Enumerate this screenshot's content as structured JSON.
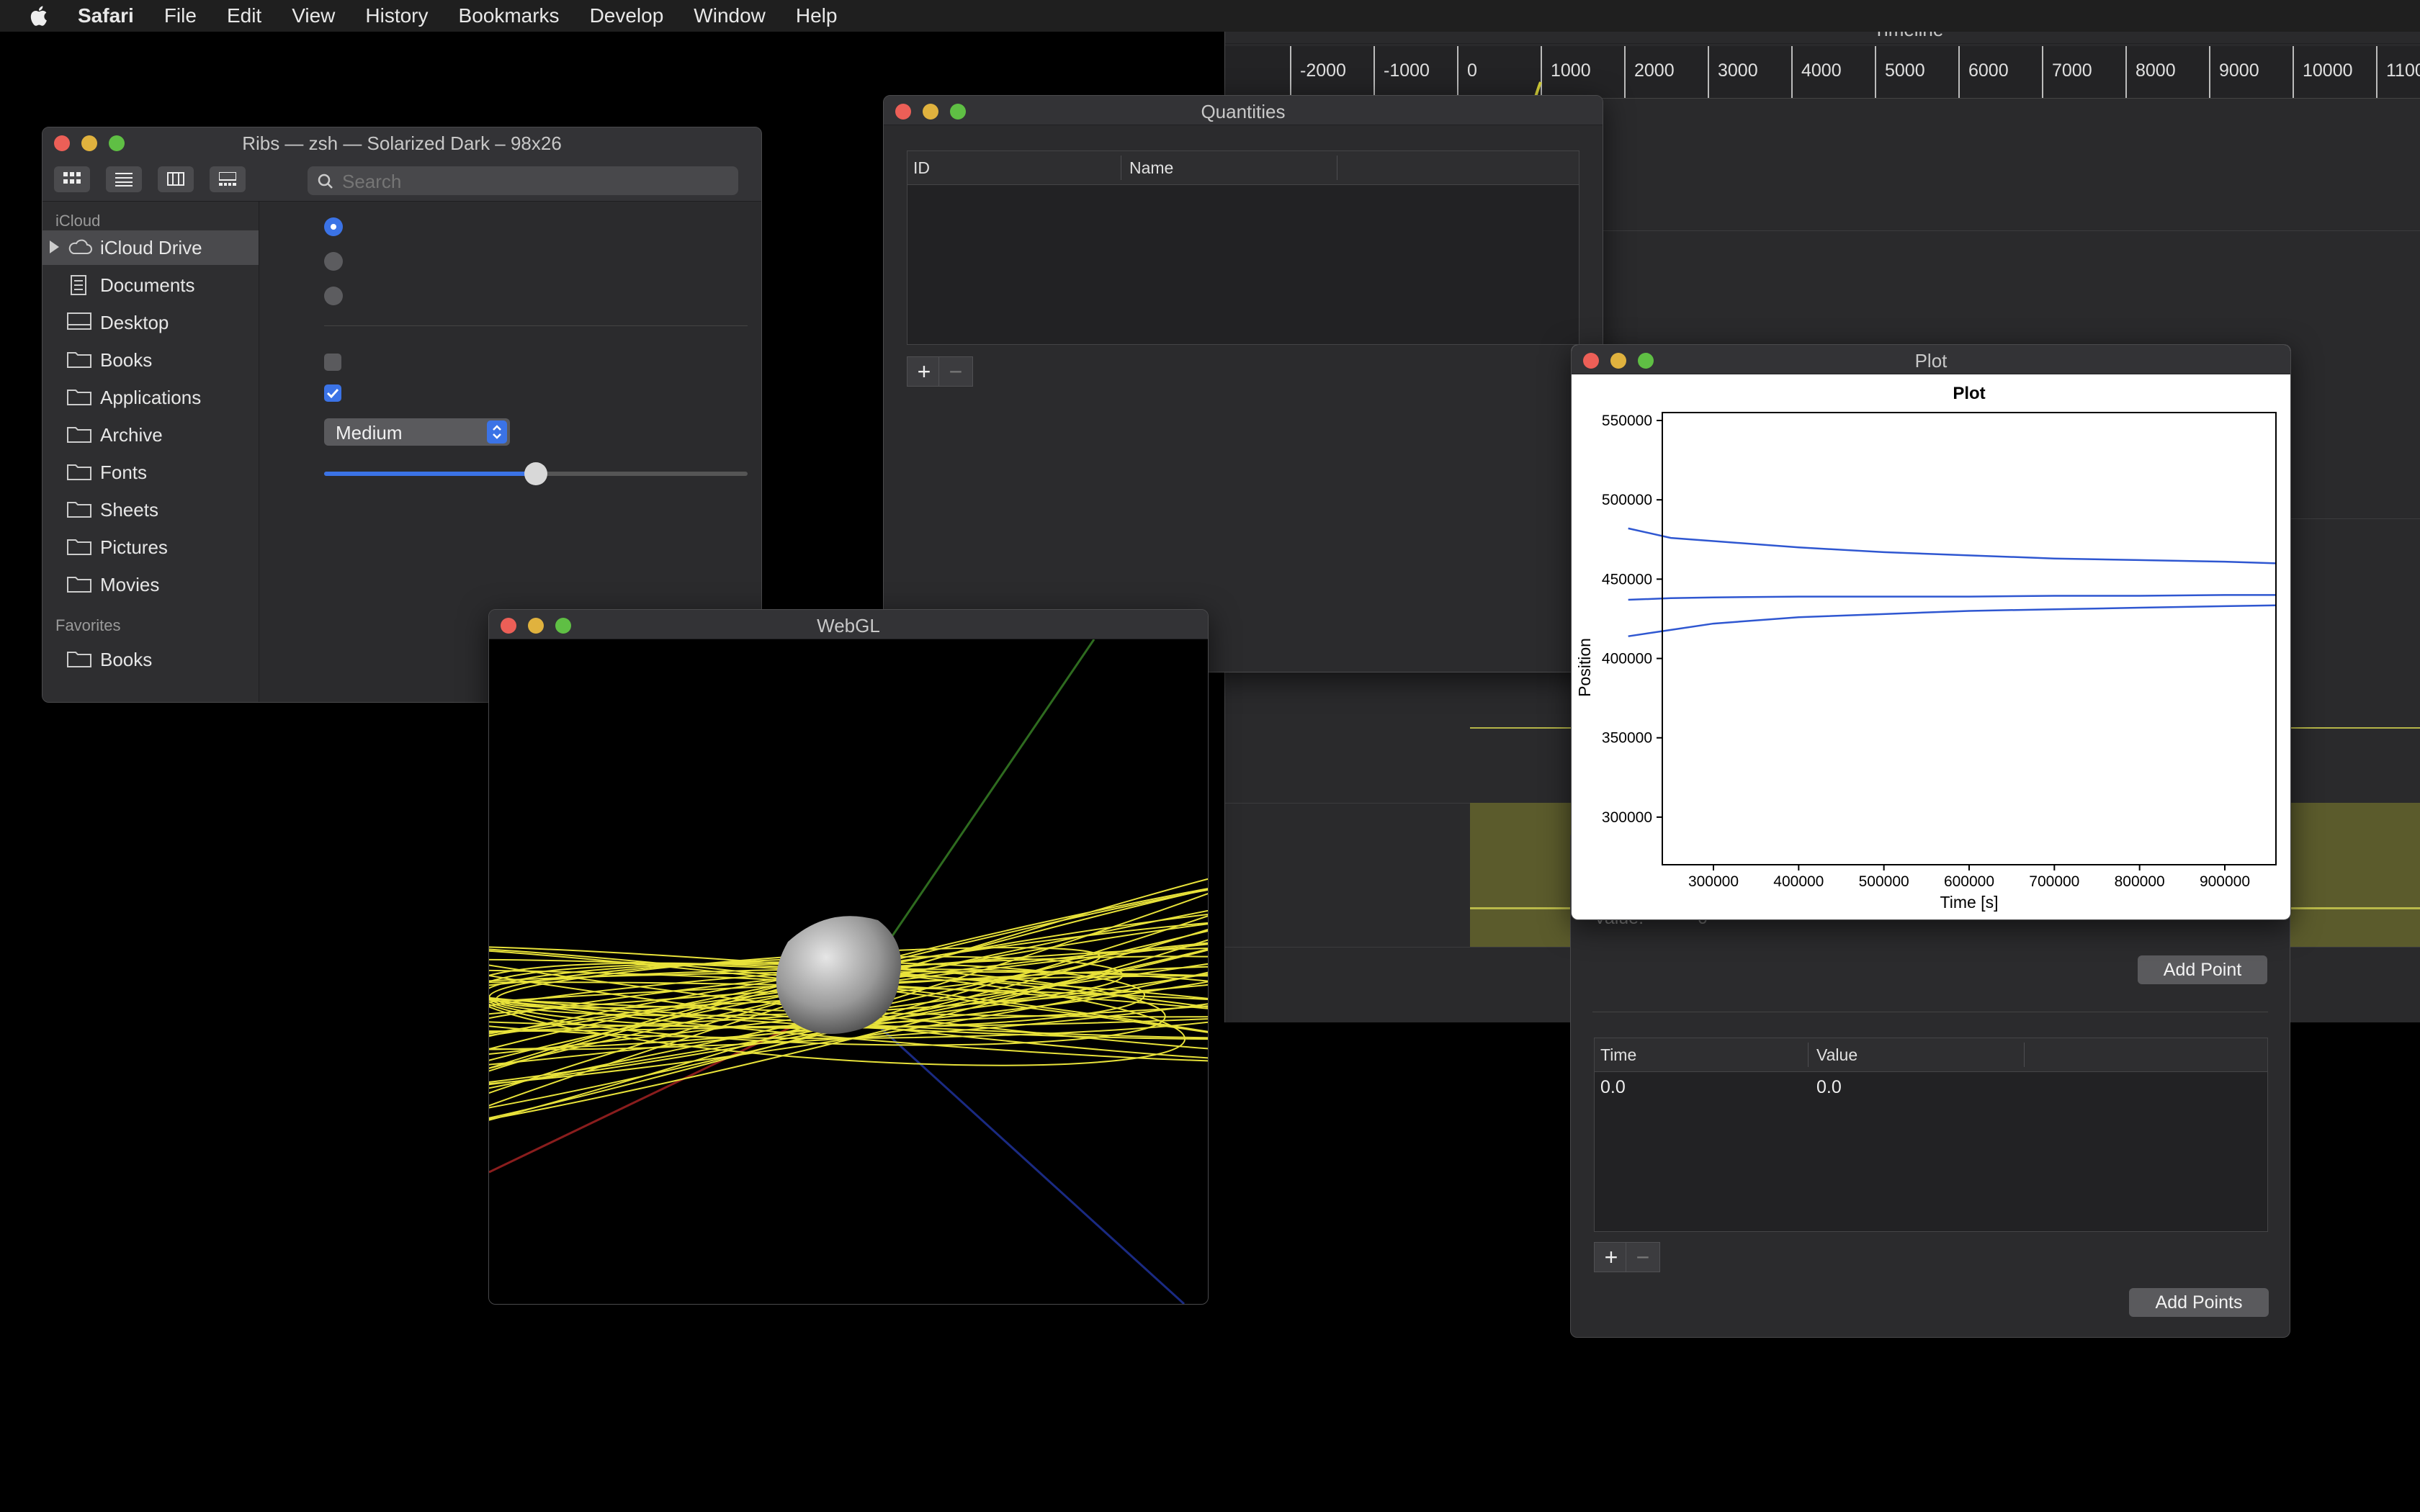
{
  "menubar": {
    "app": "Safari",
    "items": [
      "File",
      "Edit",
      "View",
      "History",
      "Bookmarks",
      "Develop",
      "Window",
      "Help"
    ]
  },
  "timeline": {
    "title": "Timeline",
    "ticks": [
      "-2000",
      "-1000",
      "0",
      "1000",
      "2000",
      "3000",
      "4000",
      "5000",
      "6000",
      "7000",
      "8000",
      "9000",
      "10000",
      "1100"
    ]
  },
  "finder": {
    "title": "Ribs — zsh — Solarized Dark – 98x26",
    "search_placeholder": "Search",
    "sidebar": {
      "icloud_header": "iCloud",
      "icloud_items": [
        "iCloud Drive",
        "Documents",
        "Desktop",
        "Books",
        "Applications",
        "Archive",
        "Fonts",
        "Sheets",
        "Pictures",
        "Movies"
      ],
      "favorites_header": "Favorites",
      "favorites_items": [
        "Books"
      ]
    },
    "controls": {
      "radios": [
        true,
        false,
        false
      ],
      "checkboxes": [
        false,
        true
      ],
      "select_value": "Medium",
      "slider_value": 0.5
    }
  },
  "quantities": {
    "title": "Quantities",
    "columns": [
      "ID",
      "Name"
    ]
  },
  "points": {
    "value_label": "Value:",
    "value_field": "0",
    "add_point": "Add Point",
    "columns": [
      "Time",
      "Value"
    ],
    "rows": [
      [
        "0.0",
        "0.0"
      ]
    ],
    "add_points": "Add Points"
  },
  "plot": {
    "window_title": "Plot",
    "chart_data": {
      "type": "line",
      "title": "Plot",
      "xlabel": "Time [s]",
      "ylabel": "Position",
      "xlim": [
        240000,
        960000
      ],
      "ylim": [
        270000,
        555000
      ],
      "xticks": [
        "300000",
        "400000",
        "500000",
        "600000",
        "700000",
        "800000",
        "900000"
      ],
      "yticks": [
        "300000",
        "350000",
        "400000",
        "450000",
        "500000",
        "550000"
      ],
      "series": [
        {
          "x": [
            200000,
            250000,
            300000,
            400000,
            500000,
            600000,
            700000,
            800000,
            900000,
            960000
          ],
          "values": [
            482000,
            476000,
            474000,
            470000,
            467000,
            465000,
            463000,
            462000,
            461000,
            460000
          ]
        },
        {
          "x": [
            200000,
            250000,
            300000,
            400000,
            500000,
            600000,
            700000,
            800000,
            900000,
            960000
          ],
          "values": [
            437000,
            438000,
            438500,
            439000,
            439000,
            439000,
            439500,
            439500,
            440000,
            440000
          ]
        },
        {
          "x": [
            200000,
            250000,
            300000,
            400000,
            500000,
            600000,
            700000,
            800000,
            900000,
            960000
          ],
          "values": [
            414000,
            418000,
            422000,
            426000,
            428000,
            430000,
            431000,
            432000,
            433000,
            433500
          ]
        }
      ],
      "line_color": "#2f57d1"
    }
  },
  "webgl": {
    "title": "WebGL"
  }
}
